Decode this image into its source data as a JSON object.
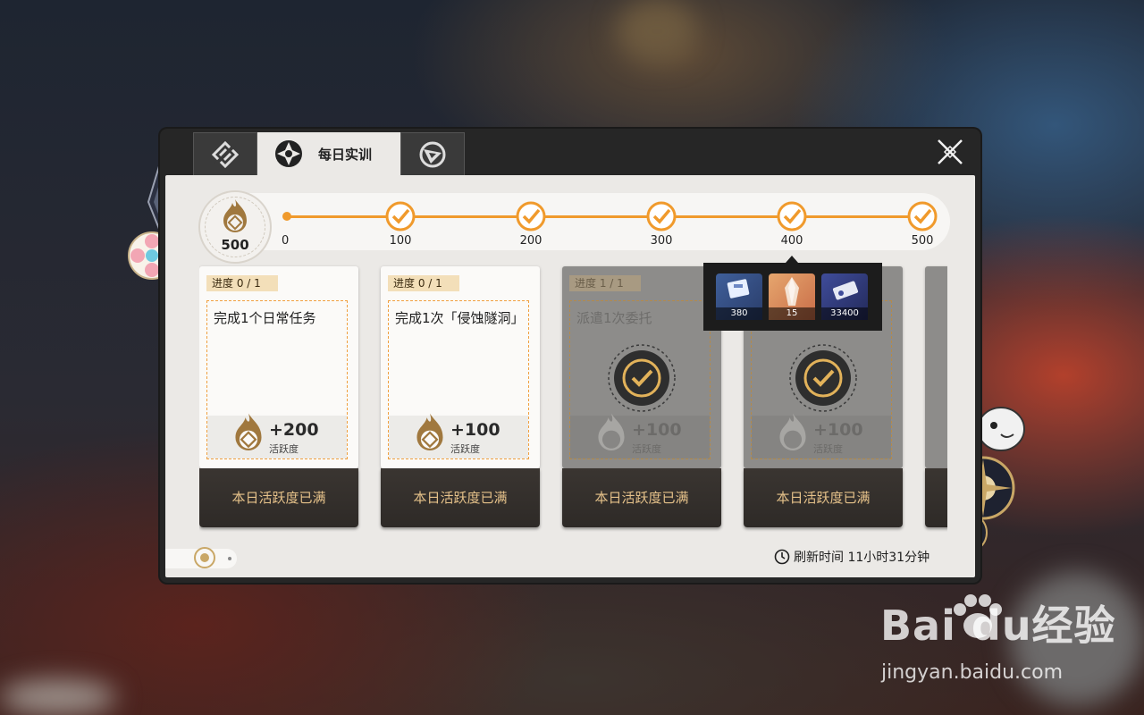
{
  "tabs": [
    {
      "icon": "tasks-icon"
    },
    {
      "icon": "daily-training-icon",
      "label": "每日实训"
    },
    {
      "icon": "target-icon"
    }
  ],
  "activity": {
    "badge_value": "500",
    "ticks": [
      "0",
      "100",
      "200",
      "300",
      "400",
      "500"
    ],
    "current": 500,
    "accent_color": "#f09a2c"
  },
  "tasks": [
    {
      "progress": "进度 0 / 1",
      "title": "完成1个日常任务",
      "reward": "+200",
      "reward_unit": "活跃度",
      "button": "本日活跃度已满",
      "completed": false
    },
    {
      "progress": "进度 0 / 1",
      "title": "完成1次「侵蚀隧洞」",
      "reward": "+100",
      "reward_unit": "活跃度",
      "button": "本日活跃度已满",
      "completed": false
    },
    {
      "progress": "进度 1 / 1",
      "title": "派遣1次委托",
      "reward": "+100",
      "reward_unit": "活跃度",
      "button": "本日活跃度已满",
      "completed": true
    },
    {
      "progress": "",
      "title": "",
      "reward": "+100",
      "reward_unit": "活跃度",
      "button": "本日活跃度已满",
      "completed": true
    }
  ],
  "reward_tooltip": {
    "items": [
      {
        "icon": "exp-material-icon",
        "qty": "380"
      },
      {
        "icon": "crystal-icon",
        "qty": "15"
      },
      {
        "icon": "credit-icon",
        "qty": "33400"
      }
    ]
  },
  "refresh": {
    "label": "刷新时间",
    "value": "11小时31分钟"
  },
  "watermark": {
    "logo": "Bai  du经验",
    "url": "jingyan.baidu.com"
  }
}
